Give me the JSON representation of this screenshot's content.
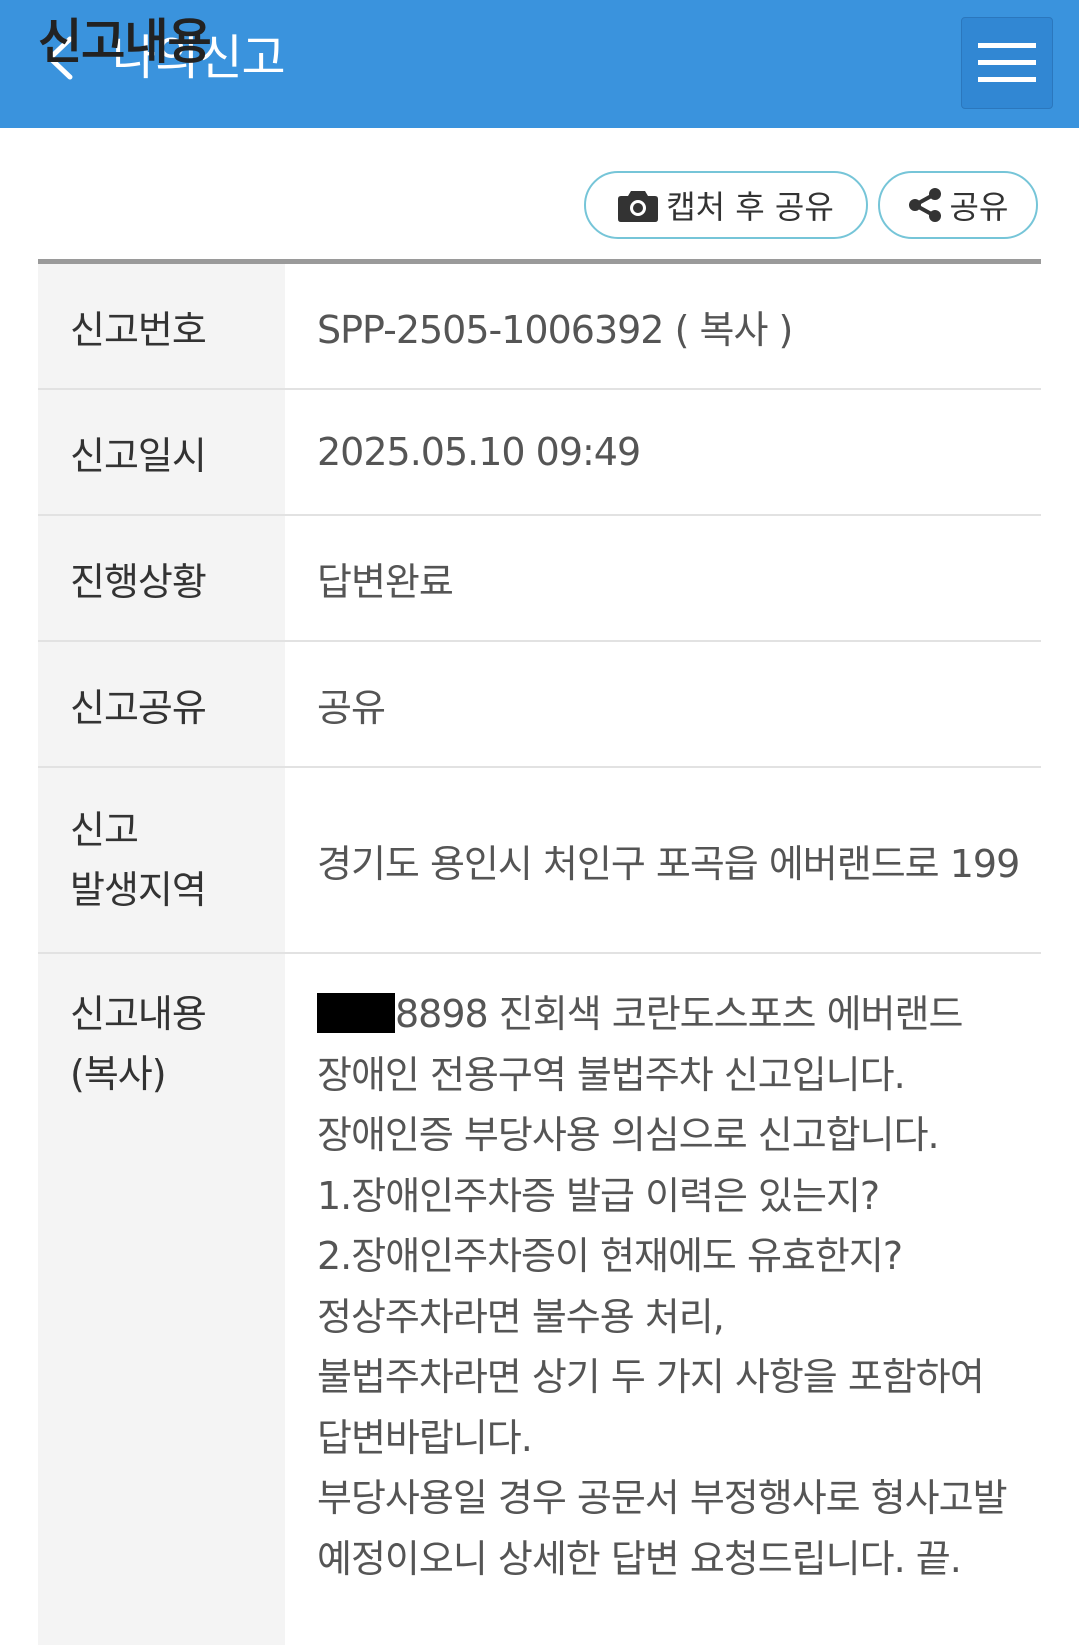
{
  "header": {
    "title": "나의신고",
    "accent_color": "#3a93dd"
  },
  "section": {
    "title": "신고내용",
    "capture_share_label": "캡처 후 공유",
    "share_label": "공유"
  },
  "details": {
    "report_number_label": "신고번호",
    "report_number": "SPP-2505-1006392",
    "copy_label": "( 복사 )",
    "report_date_label": "신고일시",
    "report_date": "2025.05.10 09:49",
    "status_label": "진행상황",
    "status": "답변완료",
    "status_color": "#5bb8d8",
    "sharing_label": "신고공유",
    "sharing": "공유",
    "region_label_line1": "신고",
    "region_label_line2": "발생지역",
    "region": "경기도 용인시 처인구 포곡읍 에버랜드로 199",
    "content_label_line1": "신고내용",
    "content_label_line2": "(복사)",
    "content_lines": [
      "8898 진회색 코란도스포츠 에버랜드",
      "장애인 전용구역 불법주차 신고입니다.",
      "장애인증 부당사용 의심으로 신고합니다.",
      "1.장애인주차증 발급 이력은 있는지?",
      "2.장애인주차증이 현재에도 유효한지?",
      "정상주차라면 불수용 처리,",
      "불법주차라면 상기 두 가지 사항을 포함하여",
      "답변바랍니다.",
      "부당사용일 경우 공문서 부정행사로 형사고발",
      "예정이오니 상세한 답변 요청드립니다. 끝."
    ]
  }
}
